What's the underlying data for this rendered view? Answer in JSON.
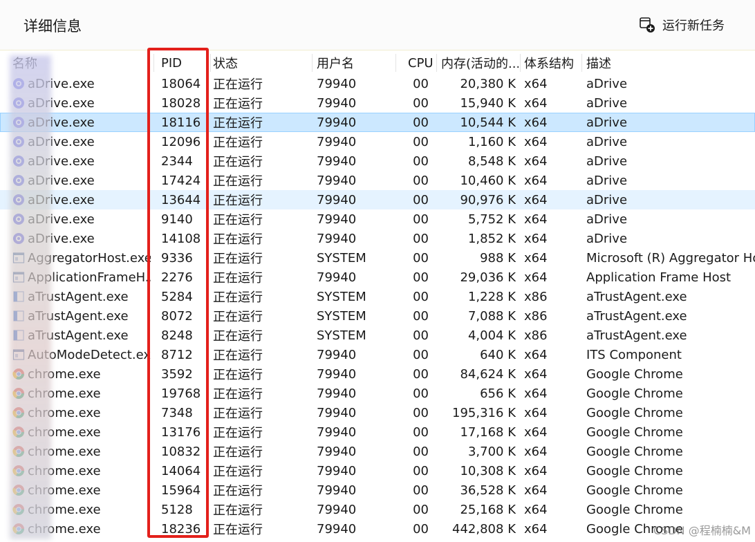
{
  "header": {
    "title": "详细信息",
    "run_task_label": "运行新任务"
  },
  "columns": {
    "name": "名称",
    "pid": "PID",
    "status": "状态",
    "user": "用户名",
    "cpu": "CPU",
    "memory": "内存(活动的...",
    "arch": "体系结构",
    "desc": "描述"
  },
  "rows": [
    {
      "name": "aDrive.exe",
      "pid": "18064",
      "status": "正在运行",
      "user": "79940",
      "cpu": "00",
      "memory": "20,380 K",
      "arch": "x64",
      "desc": "aDrive",
      "icon": "adrive-icon"
    },
    {
      "name": "aDrive.exe",
      "pid": "18028",
      "status": "正在运行",
      "user": "79940",
      "cpu": "00",
      "memory": "15,940 K",
      "arch": "x64",
      "desc": "aDrive",
      "icon": "adrive-icon"
    },
    {
      "name": "aDrive.exe",
      "pid": "18116",
      "status": "正在运行",
      "user": "79940",
      "cpu": "00",
      "memory": "10,544 K",
      "arch": "x64",
      "desc": "aDrive",
      "icon": "adrive-icon",
      "selected": true
    },
    {
      "name": "aDrive.exe",
      "pid": "12096",
      "status": "正在运行",
      "user": "79940",
      "cpu": "00",
      "memory": "1,160 K",
      "arch": "x64",
      "desc": "aDrive",
      "icon": "adrive-icon"
    },
    {
      "name": "aDrive.exe",
      "pid": "2344",
      "status": "正在运行",
      "user": "79940",
      "cpu": "00",
      "memory": "8,548 K",
      "arch": "x64",
      "desc": "aDrive",
      "icon": "adrive-icon"
    },
    {
      "name": "aDrive.exe",
      "pid": "17424",
      "status": "正在运行",
      "user": "79940",
      "cpu": "00",
      "memory": "10,460 K",
      "arch": "x64",
      "desc": "aDrive",
      "icon": "adrive-icon"
    },
    {
      "name": "aDrive.exe",
      "pid": "13644",
      "status": "正在运行",
      "user": "79940",
      "cpu": "00",
      "memory": "90,976 K",
      "arch": "x64",
      "desc": "aDrive",
      "icon": "adrive-icon",
      "hovered": true
    },
    {
      "name": "aDrive.exe",
      "pid": "9140",
      "status": "正在运行",
      "user": "79940",
      "cpu": "00",
      "memory": "5,752 K",
      "arch": "x64",
      "desc": "aDrive",
      "icon": "adrive-icon"
    },
    {
      "name": "aDrive.exe",
      "pid": "14108",
      "status": "正在运行",
      "user": "79940",
      "cpu": "00",
      "memory": "1,852 K",
      "arch": "x64",
      "desc": "aDrive",
      "icon": "adrive-icon"
    },
    {
      "name": "AggregatorHost.exe",
      "pid": "9336",
      "status": "正在运行",
      "user": "SYSTEM",
      "cpu": "00",
      "memory": "988 K",
      "arch": "x64",
      "desc": "Microsoft (R) Aggregator Ho",
      "icon": "app-window-icon"
    },
    {
      "name": "ApplicationFrameH...",
      "pid": "2276",
      "status": "正在运行",
      "user": "79940",
      "cpu": "00",
      "memory": "29,036 K",
      "arch": "x64",
      "desc": "Application Frame Host",
      "icon": "app-window-icon"
    },
    {
      "name": "aTrustAgent.exe",
      "pid": "5284",
      "status": "正在运行",
      "user": "SYSTEM",
      "cpu": "00",
      "memory": "1,228 K",
      "arch": "x86",
      "desc": "aTrustAgent.exe",
      "icon": "atrust-icon"
    },
    {
      "name": "aTrustAgent.exe",
      "pid": "8072",
      "status": "正在运行",
      "user": "SYSTEM",
      "cpu": "00",
      "memory": "7,088 K",
      "arch": "x86",
      "desc": "aTrustAgent.exe",
      "icon": "atrust-icon"
    },
    {
      "name": "aTrustAgent.exe",
      "pid": "8248",
      "status": "正在运行",
      "user": "SYSTEM",
      "cpu": "00",
      "memory": "4,004 K",
      "arch": "x86",
      "desc": "aTrustAgent.exe",
      "icon": "atrust-icon"
    },
    {
      "name": "AutoModeDetect.exe",
      "pid": "8712",
      "status": "正在运行",
      "user": "79940",
      "cpu": "00",
      "memory": "640 K",
      "arch": "x64",
      "desc": "ITS Component",
      "icon": "app-window-icon"
    },
    {
      "name": "chrome.exe",
      "pid": "3592",
      "status": "正在运行",
      "user": "79940",
      "cpu": "00",
      "memory": "84,624 K",
      "arch": "x64",
      "desc": "Google Chrome",
      "icon": "chrome-icon"
    },
    {
      "name": "chrome.exe",
      "pid": "19768",
      "status": "正在运行",
      "user": "79940",
      "cpu": "00",
      "memory": "656 K",
      "arch": "x64",
      "desc": "Google Chrome",
      "icon": "chrome-icon"
    },
    {
      "name": "chrome.exe",
      "pid": "7348",
      "status": "正在运行",
      "user": "79940",
      "cpu": "00",
      "memory": "195,316 K",
      "arch": "x64",
      "desc": "Google Chrome",
      "icon": "chrome-icon"
    },
    {
      "name": "chrome.exe",
      "pid": "13176",
      "status": "正在运行",
      "user": "79940",
      "cpu": "00",
      "memory": "17,168 K",
      "arch": "x64",
      "desc": "Google Chrome",
      "icon": "chrome-icon"
    },
    {
      "name": "chrome.exe",
      "pid": "10832",
      "status": "正在运行",
      "user": "79940",
      "cpu": "00",
      "memory": "3,700 K",
      "arch": "x64",
      "desc": "Google Chrome",
      "icon": "chrome-icon"
    },
    {
      "name": "chrome.exe",
      "pid": "14064",
      "status": "正在运行",
      "user": "79940",
      "cpu": "00",
      "memory": "10,308 K",
      "arch": "x64",
      "desc": "Google Chrome",
      "icon": "chrome-icon"
    },
    {
      "name": "chrome.exe",
      "pid": "15964",
      "status": "正在运行",
      "user": "79940",
      "cpu": "00",
      "memory": "36,528 K",
      "arch": "x64",
      "desc": "Google Chrome",
      "icon": "chrome-icon"
    },
    {
      "name": "chrome.exe",
      "pid": "5128",
      "status": "正在运行",
      "user": "79940",
      "cpu": "00",
      "memory": "25,168 K",
      "arch": "x64",
      "desc": "Google Chrome",
      "icon": "chrome-icon"
    },
    {
      "name": "chrome.exe",
      "pid": "18236",
      "status": "正在运行",
      "user": "79940",
      "cpu": "00",
      "memory": "442,808 K",
      "arch": "x64",
      "desc": "Google Chrome",
      "icon": "chrome-icon"
    }
  ],
  "watermark": "CSDN @程楠楠&M",
  "colors": {
    "selected_row": "#cce8ff",
    "hover_row": "#e5f3ff",
    "highlight_box": "#e3201b"
  }
}
